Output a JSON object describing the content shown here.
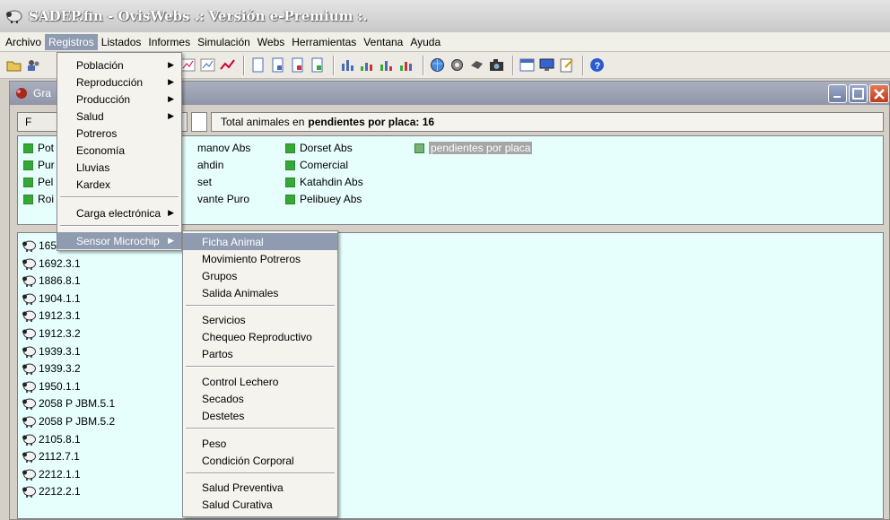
{
  "window": {
    "title": "SADEP.fin - OvisWebs  .: Versión e-Premium :."
  },
  "menubar": {
    "items": [
      "Archivo",
      "Registros",
      "Listados",
      "Informes",
      "Simulación",
      "Webs",
      "Herramientas",
      "Ventana",
      "Ayuda"
    ],
    "active": "Registros"
  },
  "child": {
    "title": "Gra",
    "button_label": "F"
  },
  "total": {
    "label": "Total animales en",
    "value": "pendientes por placa: 16"
  },
  "legend": {
    "items": [
      "Pot",
      "Pur",
      "Pel",
      "Roi",
      "manov Abs",
      "ahdin",
      "set",
      "vante Puro",
      "Dorset Abs",
      "Comercial",
      "Katahdin Abs",
      "Pelibuey Abs",
      "pendientes por placa"
    ],
    "selected": "pendientes por placa"
  },
  "list": {
    "items": [
      "165",
      "1692.3.1",
      "1886.8.1",
      "1904.1.1",
      "1912.3.1",
      "1912.3.2",
      "1939.3.1",
      "1939.3.2",
      "1950.1.1",
      "2058 P JBM.5.1",
      "2058 P JBM.5.2",
      "2105.8.1",
      "2112.7.1",
      "2212.1.1",
      "2212.2.1"
    ]
  },
  "registros_menu": {
    "items": [
      "Población",
      "Reproducción",
      "Producción",
      "Salud",
      "Potreros",
      "Economía",
      "Lluvias",
      "Kardex",
      "Carga electrónica",
      "Sensor Microchip"
    ],
    "highlighted": "Sensor Microchip"
  },
  "sensor_menu": {
    "items": [
      "Ficha Animal",
      "Movimiento Potreros",
      "Grupos",
      "Salida Animales",
      "Servicios",
      "Chequeo Reproductivo",
      "Partos",
      "Control Lechero",
      "Secados",
      "Destetes",
      "Peso",
      "Condición Corporal",
      "Salud Preventiva",
      "Salud Curativa"
    ],
    "highlighted": "Ficha Animal"
  },
  "icons": [
    "folder-open-icon",
    "people-icon",
    "chart-icon",
    "chart-icon",
    "trend-icon",
    "document-icon",
    "document-icon",
    "document-icon",
    "document-icon",
    "bar-chart-icon",
    "chart-icon",
    "chart-icon",
    "chart-icon",
    "globe-icon",
    "gear-icon",
    "tool-icon",
    "camera-icon",
    "calendar-icon",
    "monitor-icon",
    "notepad-icon",
    "help-icon"
  ],
  "colors": {
    "legend_swatch": "#35a838",
    "panel_bg": "#e6fffc",
    "menu_highlight": "#8e9bb0",
    "close_button": "#c0391a"
  }
}
